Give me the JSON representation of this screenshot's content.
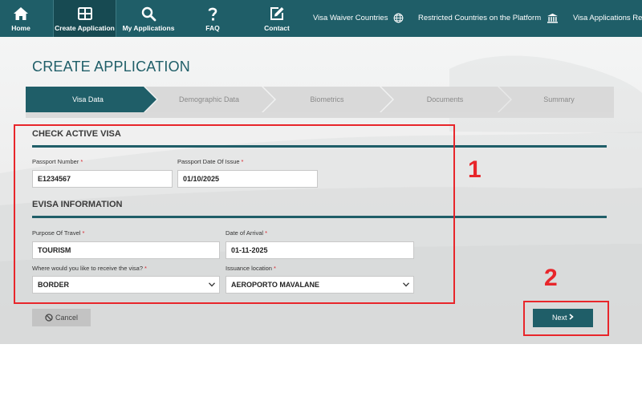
{
  "topnav": {
    "items": [
      {
        "label": "Home",
        "icon": "home-icon"
      },
      {
        "label": "Create Application",
        "icon": "grid-icon"
      },
      {
        "label": "My Applications",
        "icon": "search-icon"
      },
      {
        "label": "FAQ",
        "icon": "question-icon"
      },
      {
        "label": "Contact",
        "icon": "edit-icon"
      }
    ],
    "links": [
      {
        "label": "Visa Waiver Countries",
        "icon": "globe-icon"
      },
      {
        "label": "Restricted Countries on the Platform",
        "icon": "institution-icon"
      },
      {
        "label": "Visa Applications Req",
        "icon": ""
      }
    ],
    "active_index": 1
  },
  "page": {
    "title": "CREATE APPLICATION"
  },
  "steps": [
    {
      "label": "Visa Data",
      "active": true
    },
    {
      "label": "Demographic Data",
      "active": false
    },
    {
      "label": "Biometrics",
      "active": false
    },
    {
      "label": "Documents",
      "active": false
    },
    {
      "label": "Summary",
      "active": false
    }
  ],
  "check_visa": {
    "title": "CHECK ACTIVE VISA",
    "passport_number": {
      "label": "Passport Number",
      "value": "E1234567"
    },
    "passport_issue": {
      "label": "Passport Date Of Issue",
      "value": "01/10/2025"
    }
  },
  "evisa": {
    "title": "EVISA INFORMATION",
    "purpose": {
      "label": "Purpose Of Travel",
      "value": "TOURISM"
    },
    "arrival": {
      "label": "Date of Arrival",
      "value": "01-11-2025"
    },
    "receive": {
      "label": "Where would you like to receive the visa?",
      "value": "BORDER"
    },
    "issuance": {
      "label": "Issuance location",
      "value": "AEROPORTO MAVALANE"
    }
  },
  "required_marker": "*",
  "buttons": {
    "cancel": "Cancel",
    "next": "Next"
  },
  "annotations": {
    "box1": "1",
    "box2": "2"
  },
  "colors": {
    "brand": "#1f5e68",
    "required": "#d9262e",
    "annotation": "#e8262b"
  }
}
